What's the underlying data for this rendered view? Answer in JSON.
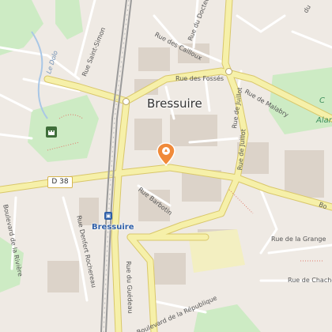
{
  "map": {
    "city_label": "Bressuire",
    "station_label": "Bressuire",
    "route_shield": "D 38",
    "park_label": "Alam",
    "park_label_top": "C",
    "river_label": "Le Dolo",
    "streets": {
      "saint_simon": "Rue Saint-Simon",
      "cailloux": "Rue des Cailloux",
      "docteur": "Rue du Docteur",
      "fosses": "Rue des Fossés",
      "juillot": "Rue de Juillot",
      "juillot2": "Rue de Juillot",
      "malabry": "Rue de Malabry",
      "barbotin": "Rue Barbotin",
      "bd_riviere": "Boulevard de la Rivière",
      "denfert": "Rue Denfert Rochereau",
      "gueideau": "Rue du Guédeau",
      "republique": "Boulevard de la République",
      "grange": "Rue de la Grange",
      "chachet": "Rue de Chache",
      "bo": "Bo",
      "du": "du"
    },
    "colors": {
      "background": "#efeae4",
      "major_road": "#f6f0a9",
      "major_road_casing": "#d9c76a",
      "minor_road": "#ffffff",
      "park": "#cdebc4",
      "building": "#dcd3c9",
      "railway": "#9a9a9a",
      "marker": "#f08a3a",
      "station": "#2f5fa8"
    },
    "icons": [
      "location-marker-icon",
      "train-station-icon",
      "castle-icon"
    ]
  }
}
